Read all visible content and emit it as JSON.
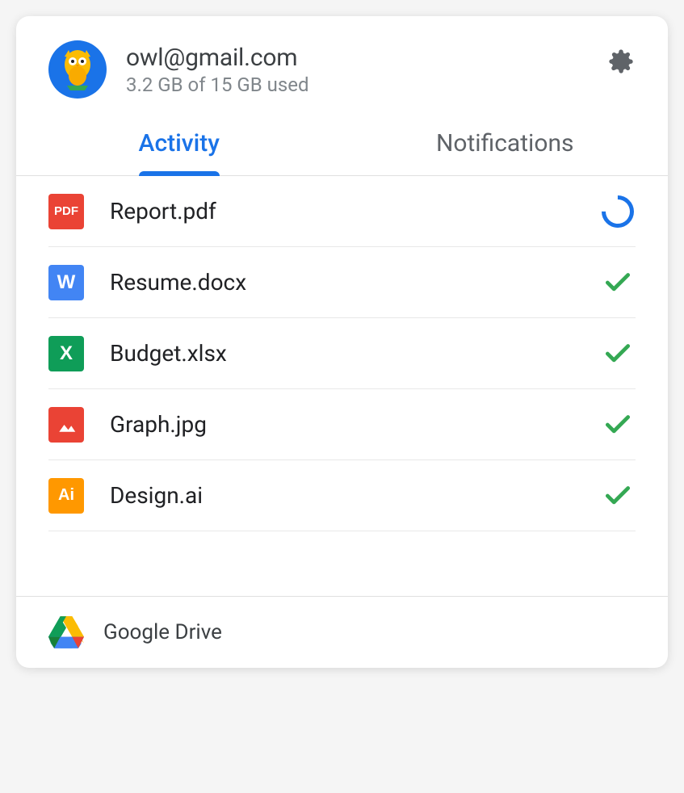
{
  "account": {
    "email": "owl@gmail.com",
    "storage": "3.2 GB of 15 GB used"
  },
  "tabs": [
    {
      "label": "Activity",
      "active": true
    },
    {
      "label": "Notifications",
      "active": false
    }
  ],
  "files": [
    {
      "name": "Report.pdf",
      "type": "pdf",
      "icon_label": "PDF",
      "status": "syncing"
    },
    {
      "name": "Resume.docx",
      "type": "docx",
      "icon_label": "W",
      "status": "done"
    },
    {
      "name": "Budget.xlsx",
      "type": "xlsx",
      "icon_label": "X",
      "status": "done"
    },
    {
      "name": "Graph.jpg",
      "type": "jpg",
      "icon_label": "",
      "status": "done"
    },
    {
      "name": "Design.ai",
      "type": "ai",
      "icon_label": "Ai",
      "status": "done"
    }
  ],
  "footer": {
    "label": "Google Drive"
  },
  "colors": {
    "blue": "#1a73e8",
    "green_check": "#34a853",
    "text_primary": "#202124",
    "text_secondary": "#5f6368"
  }
}
